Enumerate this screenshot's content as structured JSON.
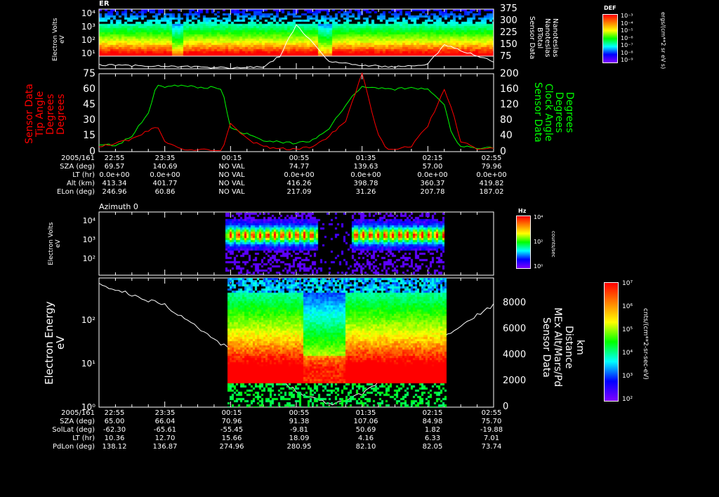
{
  "time_ticks": [
    "22:55",
    "23:35",
    "00:15",
    "00:55",
    "01:35",
    "02:15",
    "02:55"
  ],
  "panel1": {
    "title": "ER",
    "ylabel": [
      "Electron Volts",
      "eV"
    ],
    "yticks": [
      "10⁴",
      "10³",
      "10²",
      "10¹"
    ],
    "right_ticks": [
      "375",
      "300",
      "225",
      "150",
      "75"
    ],
    "right_label": [
      "Sensor Data",
      "BTotal",
      "Nanoteslas",
      "Nanoteslas"
    ],
    "colorbar": {
      "title": "DEF",
      "ticks": [
        "10⁻³",
        "10⁻⁴",
        "10⁻⁵",
        "10⁻⁶",
        "10⁻⁷",
        "10⁻⁸",
        "10⁻⁹"
      ],
      "unit": "ergs/(cm**2 sr eV s)"
    }
  },
  "panel2": {
    "left_label": [
      "Sensor Data",
      "Tip Angle",
      "Degrees",
      "Degrees"
    ],
    "left_ticks": [
      "75",
      "60",
      "45",
      "30",
      "15",
      "0"
    ],
    "right_label": [
      "Sensor Data",
      "Clock Angle",
      "Degrees",
      "Degrees"
    ],
    "right_ticks": [
      "200",
      "160",
      "120",
      "80",
      "40",
      "0"
    ],
    "colors": {
      "tip": "#ff0000",
      "clock": "#00ff00"
    }
  },
  "table1": {
    "date": "2005/161",
    "rows": [
      {
        "label": "SZA (deg)",
        "values": [
          "69.57",
          "140.69",
          "NO VAL",
          "74.77",
          "139.63",
          "57.00",
          "79.96"
        ]
      },
      {
        "label": "LT (hr)",
        "values": [
          "0.0e+00",
          "0.0e+00",
          "NO VAL",
          "0.0e+00",
          "0.0e+00",
          "0.0e+00",
          "0.0e+00"
        ]
      },
      {
        "label": "Alt (km)",
        "values": [
          "413.34",
          "401.77",
          "NO VAL",
          "416.26",
          "398.78",
          "360.37",
          "419.82"
        ]
      },
      {
        "label": "ELon (deg)",
        "values": [
          "246.96",
          "60.86",
          "NO VAL",
          "217.09",
          "31.26",
          "207.78",
          "187.02"
        ]
      }
    ]
  },
  "panel3": {
    "title": "Azimuth 0",
    "ylabel": [
      "Electron Volts",
      "eV"
    ],
    "yticks": [
      "10⁴",
      "10³",
      "10²"
    ],
    "colorbar": {
      "title": "Hz",
      "ticks": [
        "10⁴",
        "10²",
        "10⁰"
      ],
      "unit": "counts/sec"
    }
  },
  "panel4": {
    "ylabel": [
      "Electron Energy",
      "eV"
    ],
    "yticks": [
      "10²",
      "10¹",
      "10⁰"
    ],
    "right_ticks": [
      "8000",
      "6000",
      "4000",
      "2000",
      "0"
    ],
    "right_label": [
      "Sensor Data",
      "MEx Alt/Mars/Pd",
      "Distance",
      "km"
    ],
    "colorbar": {
      "ticks": [
        "10⁷",
        "10⁶",
        "10⁵",
        "10⁴",
        "10³",
        "10²"
      ],
      "unit": "cnts/(cm**2-sr-sec-eV)"
    }
  },
  "table2": {
    "date": "2005/161",
    "rows": [
      {
        "label": "SZA (deg)",
        "values": [
          "65.00",
          "66.04",
          "70.96",
          "91.38",
          "107.06",
          "84.98",
          "75.70"
        ]
      },
      {
        "label": "SolLat (deg)",
        "values": [
          "-62.30",
          "-65.61",
          "-55.45",
          "-9.81",
          "50.69",
          "1.82",
          "-19.88"
        ]
      },
      {
        "label": "LT (hr)",
        "values": [
          "10.36",
          "12.70",
          "15.66",
          "18.09",
          "4.16",
          "6.33",
          "7.01"
        ]
      },
      {
        "label": "PdLon (deg)",
        "values": [
          "138.12",
          "136.87",
          "274.96",
          "280.95",
          "82.10",
          "82.05",
          "73.74"
        ]
      }
    ]
  },
  "chart_data": [
    {
      "type": "heatmap",
      "title": "ER",
      "ylabel": "Electron Volts (eV)",
      "y_range": [
        10,
        20000
      ],
      "x_range": [
        "22:55",
        "02:55"
      ],
      "overlay": {
        "name": "BTotal (nT)",
        "ylim": [
          50,
          375
        ],
        "x_min": [
          0,
          40,
          80,
          100,
          110,
          120,
          140,
          160,
          180,
          200,
          210,
          220,
          240
        ],
        "values": [
          70,
          65,
          55,
          60,
          120,
          290,
          90,
          70,
          60,
          75,
          180,
          150,
          90
        ]
      }
    },
    {
      "type": "line",
      "ylim_left": [
        0,
        75
      ],
      "ylim_right": [
        0,
        200
      ],
      "x_min": [
        0,
        10,
        20,
        30,
        35,
        40,
        50,
        60,
        70,
        75,
        80,
        90,
        100,
        110,
        120,
        130,
        140,
        150,
        160,
        170,
        175,
        180,
        190,
        200,
        210,
        215,
        220,
        230,
        240
      ],
      "series": [
        {
          "name": "Tip Angle",
          "axis": "left",
          "values": [
            5,
            8,
            12,
            20,
            25,
            10,
            3,
            2,
            2,
            2,
            28,
            12,
            5,
            3,
            2,
            5,
            15,
            30,
            75,
            15,
            3,
            2,
            5,
            25,
            60,
            40,
            10,
            3,
            4
          ]
        },
        {
          "name": "Clock Angle",
          "axis": "right",
          "values": [
            20,
            15,
            40,
            100,
            170,
            165,
            170,
            165,
            165,
            160,
            60,
            45,
            30,
            25,
            20,
            30,
            60,
            120,
            170,
            160,
            165,
            160,
            165,
            160,
            120,
            40,
            15,
            10,
            10
          ]
        }
      ]
    },
    {
      "type": "heatmap",
      "title": "Azimuth 0",
      "ylabel": "Electron Volts (eV)",
      "colorbar": "counts/sec"
    },
    {
      "type": "heatmap",
      "ylabel": "Electron Energy (eV)",
      "y_range": [
        1,
        1000
      ],
      "overlay": {
        "name": "MEx Alt (km)",
        "ylim": [
          0,
          9500
        ],
        "x_min": [
          0,
          40,
          80,
          120,
          140,
          160,
          200,
          240
        ],
        "values": [
          9000,
          7500,
          4200,
          1200,
          200,
          1000,
          4500,
          7500
        ]
      }
    }
  ]
}
